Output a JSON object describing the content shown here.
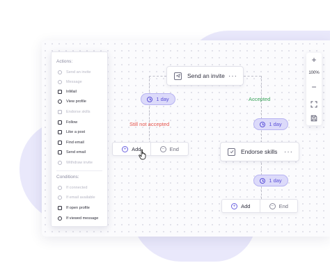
{
  "sidebar": {
    "actions_heading": "Actions:",
    "actions": [
      {
        "label": "Send an invite",
        "enabled": false,
        "icon": "send-invite-icon"
      },
      {
        "label": "Message",
        "enabled": false,
        "icon": "message-icon"
      },
      {
        "label": "InMail",
        "enabled": true,
        "icon": "inmail-icon"
      },
      {
        "label": "View profile",
        "enabled": true,
        "icon": "eye-icon"
      },
      {
        "label": "Endorse skills",
        "enabled": false,
        "icon": "endorse-icon"
      },
      {
        "label": "Follow",
        "enabled": true,
        "icon": "follow-icon"
      },
      {
        "label": "Like a post",
        "enabled": true,
        "icon": "thumbs-up-icon"
      },
      {
        "label": "Find email",
        "enabled": true,
        "icon": "find-email-icon"
      },
      {
        "label": "Send email",
        "enabled": true,
        "icon": "send-email-icon"
      },
      {
        "label": "Withdraw invite",
        "enabled": false,
        "icon": "withdraw-icon"
      }
    ],
    "conditions_heading": "Conditions:",
    "conditions": [
      {
        "label": "If connected",
        "enabled": false,
        "icon": "connected-icon"
      },
      {
        "label": "If email available",
        "enabled": false,
        "icon": "email-available-icon"
      },
      {
        "label": "If open profile",
        "enabled": true,
        "icon": "open-profile-icon"
      },
      {
        "label": "If viewed message",
        "enabled": true,
        "icon": "viewed-message-icon"
      }
    ]
  },
  "flow": {
    "invite_card": {
      "title": "Send an invite",
      "menu": "···"
    },
    "delay_left": "1 day",
    "delay_right": "1 day",
    "delay_bottom": "1 day",
    "label_not_accepted": "Still not accepted",
    "label_accepted": "Accepted",
    "endorse_card": {
      "title": "Endorse skills",
      "menu": "···"
    },
    "left_buttons": {
      "add": "Add",
      "end": "End"
    },
    "bottom_buttons": {
      "add": "Add",
      "end": "End"
    }
  },
  "zoom": {
    "plus": "+",
    "level": "100%",
    "minus": "−"
  },
  "colors": {
    "accent": "#5a50d8",
    "pill_bg": "#dcdafa",
    "not_accepted": "#e5534b",
    "accepted": "#3aa55a",
    "blob": "#e9e8fb"
  }
}
